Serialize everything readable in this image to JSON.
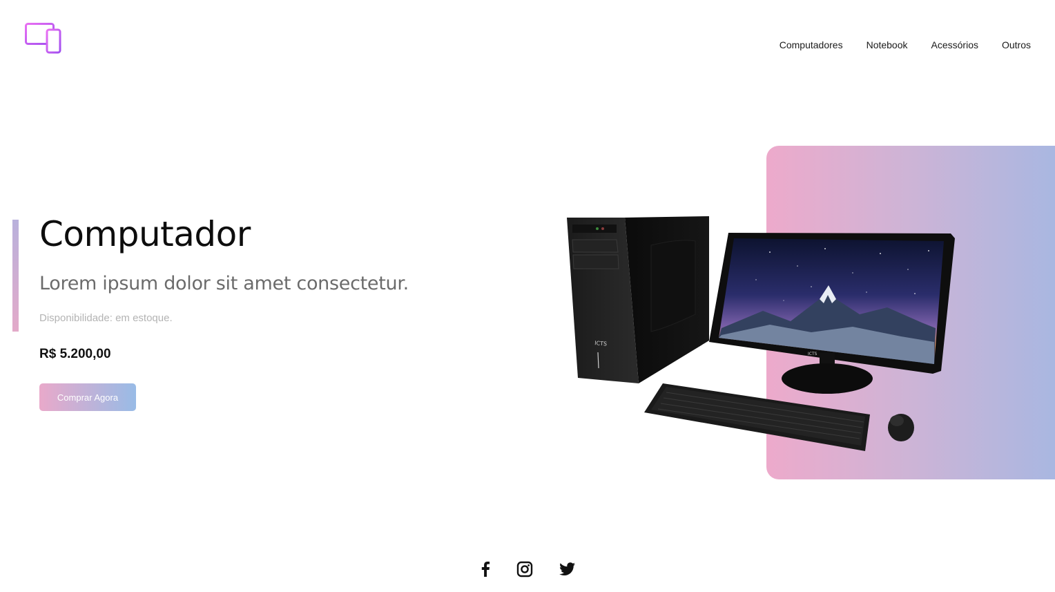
{
  "header": {
    "logo_icon": "devices-icon",
    "nav": [
      {
        "label": "Computadores"
      },
      {
        "label": "Notebook"
      },
      {
        "label": "Acessórios"
      },
      {
        "label": "Outros"
      }
    ]
  },
  "hero": {
    "title": "Computador",
    "subtitle": "Lorem ipsum dolor sit amet consectetur.",
    "availability": "Disponibilidade: em estoque.",
    "price": "R$ 5.200,00",
    "cta_label": "Comprar Agora",
    "image_icon": "desktop-computer-product-image"
  },
  "footer": {
    "social": [
      {
        "icon": "facebook-icon"
      },
      {
        "icon": "instagram-icon"
      },
      {
        "icon": "twitter-icon"
      }
    ]
  },
  "colors": {
    "logo_gradient_start": "#e55ff0",
    "logo_gradient_end": "#a54cf0",
    "panel_gradient_start": "#edaacb",
    "panel_gradient_end": "#a9b7e1",
    "button_gradient_start": "#e9a9ca",
    "button_gradient_end": "#98bbe6"
  }
}
